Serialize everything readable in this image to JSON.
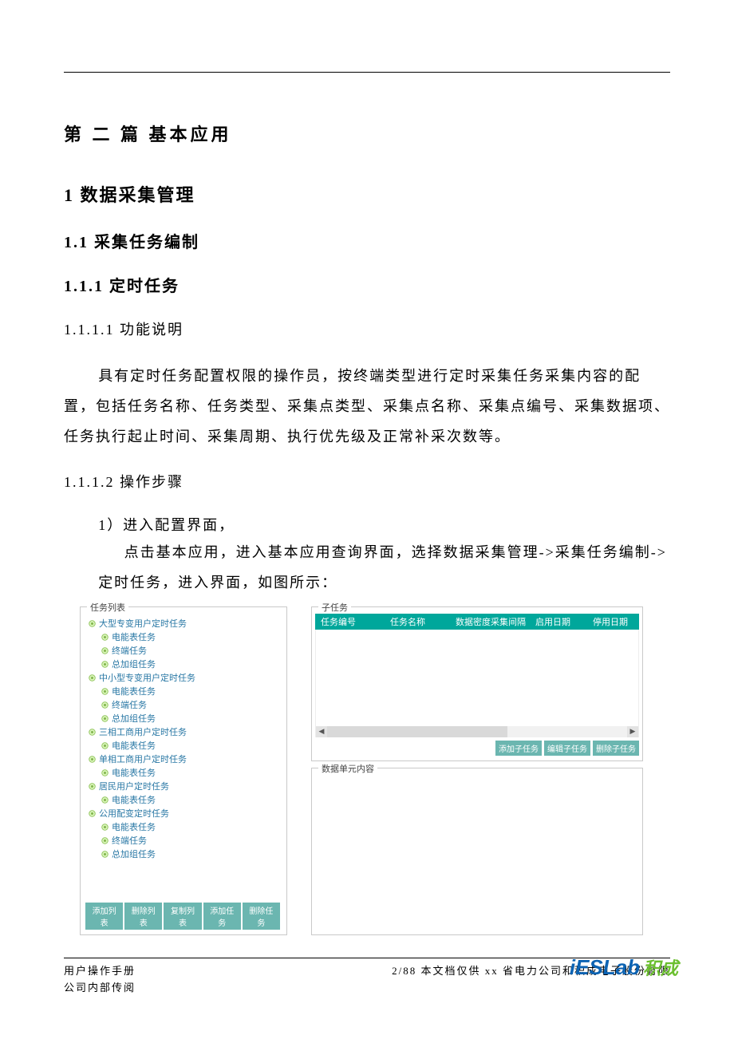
{
  "headings": {
    "part": "第 二 篇  基本应用",
    "h1": "1   数据采集管理",
    "h2": "1.1  采集任务编制",
    "h3": "1.1.1  定时任务",
    "h4a": "1.1.1.1  功能说明",
    "h4b": "1.1.1.2  操作步骤"
  },
  "para1": "具有定时任务配置权限的操作员，按终端类型进行定时采集任务采集内容的配置，包括任务名称、任务类型、采集点类型、采集点名称、采集点编号、采集数据项、任务执行起止时间、采集周期、执行优先级及正常补采次数等。",
  "step1_title": "1）进入配置界面，",
  "step1_body": "点击基本应用，进入基本应用查询界面，选择数据采集管理->采集任务编制->定时任务，进入界面，如图所示：",
  "ui": {
    "left_title": "任务列表",
    "tree": [
      {
        "lv": 1,
        "label": "大型专变用户定时任务"
      },
      {
        "lv": 2,
        "label": "电能表任务"
      },
      {
        "lv": 2,
        "label": "终端任务"
      },
      {
        "lv": 2,
        "label": "总加组任务"
      },
      {
        "lv": 1,
        "label": "中小型专变用户定时任务"
      },
      {
        "lv": 2,
        "label": "电能表任务"
      },
      {
        "lv": 2,
        "label": "终端任务"
      },
      {
        "lv": 2,
        "label": "总加组任务"
      },
      {
        "lv": 1,
        "label": "三相工商用户定时任务"
      },
      {
        "lv": 2,
        "label": "电能表任务"
      },
      {
        "lv": 1,
        "label": "单相工商用户定时任务"
      },
      {
        "lv": 2,
        "label": "电能表任务"
      },
      {
        "lv": 1,
        "label": "居民用户定时任务"
      },
      {
        "lv": 2,
        "label": "电能表任务"
      },
      {
        "lv": 1,
        "label": "公用配变定时任务"
      },
      {
        "lv": 2,
        "label": "电能表任务"
      },
      {
        "lv": 2,
        "label": "终端任务"
      },
      {
        "lv": 2,
        "label": "总加组任务"
      }
    ],
    "left_buttons": [
      "添加列表",
      "删除列表",
      "复制列表",
      "添加任务",
      "删除任务"
    ],
    "right_top_title": "子任务",
    "table_headers": [
      "任务编号",
      "任务名称",
      "数据密度",
      "采集间隔",
      "启用日期",
      "停用日期"
    ],
    "right_buttons": [
      "添加子任务",
      "编辑子任务",
      "删除子任务"
    ],
    "right_bot_title": "数据单元内容"
  },
  "footer": {
    "left_line1": "用户操作手册",
    "left_line2": "公司内部传阅",
    "right": "2/88 本文档仅供 xx 省电力公司和积成电子股份有限",
    "logo_en": "iESLab",
    "logo_cn": "积成"
  }
}
